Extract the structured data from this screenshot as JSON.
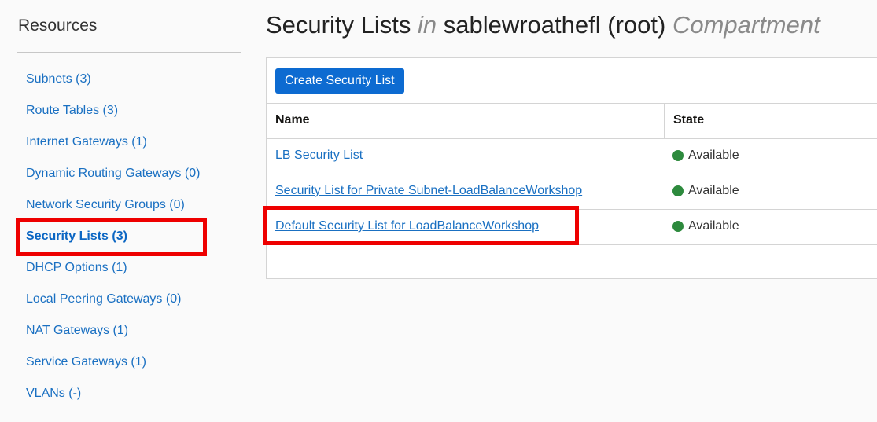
{
  "sidebar": {
    "title": "Resources",
    "items": [
      {
        "label": "Subnets (3)"
      },
      {
        "label": "Route Tables (3)"
      },
      {
        "label": "Internet Gateways (1)"
      },
      {
        "label": "Dynamic Routing Gateways (0)"
      },
      {
        "label": "Network Security Groups (0)"
      },
      {
        "label": "Security Lists (3)"
      },
      {
        "label": "DHCP Options (1)"
      },
      {
        "label": "Local Peering Gateways (0)"
      },
      {
        "label": "NAT Gateways (1)"
      },
      {
        "label": "Service Gateways (1)"
      },
      {
        "label": "VLANs (-)"
      }
    ]
  },
  "header": {
    "title": "Security Lists",
    "in_word": "in",
    "compartment_name": "sablewroathefl (root)",
    "compartment_word": "Compartment"
  },
  "toolbar": {
    "create_label": "Create Security List"
  },
  "table": {
    "columns": [
      "Name",
      "State"
    ],
    "rows": [
      {
        "name": "LB Security List",
        "state": "Available"
      },
      {
        "name": "Security List for Private Subnet-LoadBalanceWorkshop",
        "state": "Available"
      },
      {
        "name": "Default Security List for LoadBalanceWorkshop",
        "state": "Available"
      }
    ]
  },
  "colors": {
    "accent": "#0d6bd1",
    "link": "#1a70c2",
    "available": "#2d8a3d",
    "highlight": "#ee0000"
  }
}
